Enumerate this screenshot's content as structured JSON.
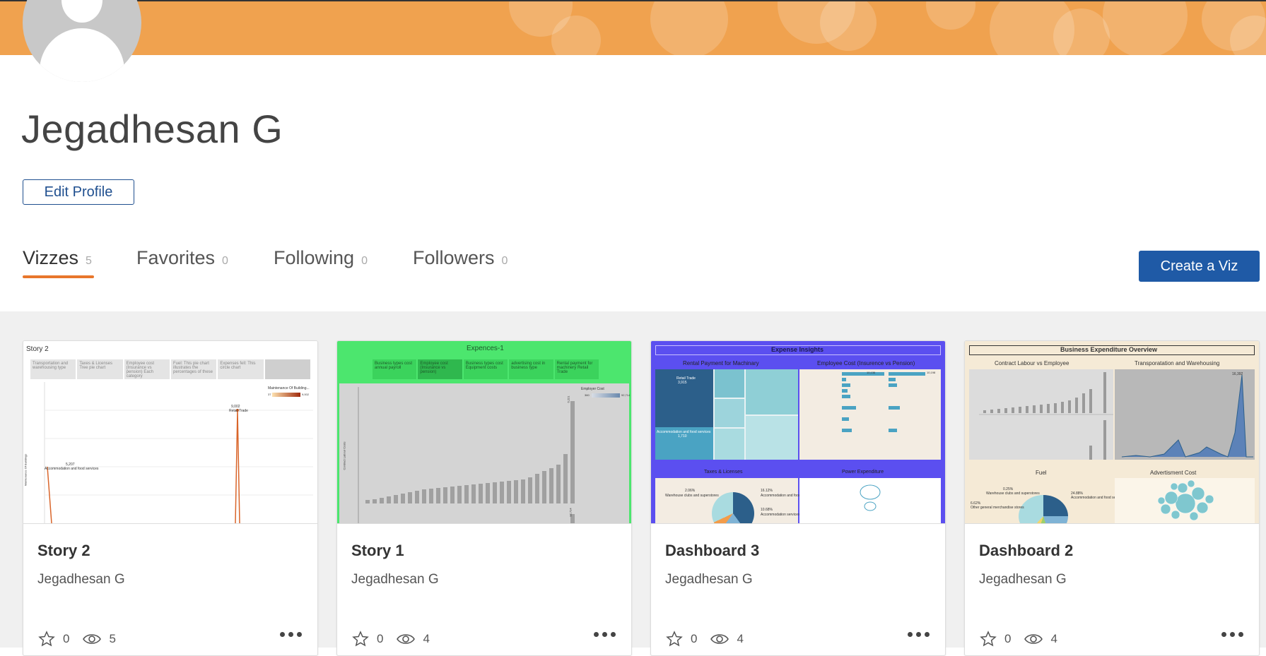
{
  "profile": {
    "name": "Jegadhesan G",
    "edit_label": "Edit Profile"
  },
  "tabs": [
    {
      "label": "Vizzes",
      "count": "5",
      "active": true
    },
    {
      "label": "Favorites",
      "count": "0",
      "active": false
    },
    {
      "label": "Following",
      "count": "0",
      "active": false
    },
    {
      "label": "Followers",
      "count": "0",
      "active": false
    }
  ],
  "create_label": "Create a Viz",
  "colors": {
    "banner": "#f0a24f",
    "accent_underline": "#e8762b",
    "primary_button": "#1f5aa6"
  },
  "cards": [
    {
      "title": "Story 2",
      "author": "Jegadhesan G",
      "favorites": "0",
      "views": "5",
      "thumb": {
        "heading": "Story 2",
        "nav": [
          "Transportation and warehousing type",
          "Taxes & Licenses Tree pie chart",
          "Employee cost (Insurance vs pension) Each category",
          "Fuel: This pie chart illustrates the percentages of these",
          "Expenses fell: This circle chart"
        ],
        "annotation_a": "5,207",
        "annotation_a_label": "Accommodation and food services",
        "annotation_b": "9,002",
        "annotation_b_label": "Retail Trade",
        "legend_title": "Maintenance Of Building...",
        "legend_min": "37",
        "legend_max": "9,002",
        "yaxis_label": "Maintenance Of Buildings"
      }
    },
    {
      "title": "Story 1",
      "author": "Jegadhesan G",
      "favorites": "0",
      "views": "4",
      "thumb": {
        "heading": "Expences-1",
        "nav": [
          "Business types cost annual payroll",
          "Employee cost (Insurance vs pension)",
          "Business types cost Equipment costs",
          "advertising cost in business type",
          "Rental payment for machinery Retail Trade"
        ],
        "legend_title": "Employer Cost",
        "legend_min": "360",
        "legend_max": "92,714",
        "yaxis_label": "Contract Labour Costs",
        "top_value": "6,221",
        "bottom_value": "92,714"
      }
    },
    {
      "title": "Dashboard 3",
      "author": "Jegadhesan G",
      "favorites": "0",
      "views": "4",
      "thumb": {
        "heading": "Expense Insights",
        "panel_a": "Rental Payment for Machinary",
        "panel_b": "Employee Cost (Insurence vs Pension)",
        "panel_c": "Taxes & Licenses",
        "panel_d": "Power Expenditure",
        "tree_a": "Retail Trade",
        "tree_a_val": "3,915",
        "tree_b": "Accommodation and food services",
        "tree_b_val": "1,710",
        "pie_a": "2.06%",
        "pie_a_label": "Warehouse clubs and superstores",
        "pie_b": "16.12%",
        "pie_b_label": "Accommodation and food services",
        "pie_c": "10.68%",
        "pie_c_label": "Accommodation services",
        "bar_a": "10,136",
        "bar_b": "10,198"
      }
    },
    {
      "title": "Dashboard 2",
      "author": "Jegadhesan G",
      "favorites": "0",
      "views": "4",
      "thumb": {
        "heading": "Business Expenditure Overview",
        "panel_a": "Contract Labour vs Employee",
        "panel_b": "Transporatation and Warehousing",
        "panel_c": "Fuel",
        "panel_d": "Advertisment Cost",
        "pie_a": "0.25%",
        "pie_a_label": "Warehouse clubs and superstores",
        "pie_b": "24.88%",
        "pie_b_label": "Accommodation and food services",
        "pie_c": "6.62%",
        "pie_c_label": "Other general merchandise stores",
        "peak": "16,392"
      }
    }
  ]
}
